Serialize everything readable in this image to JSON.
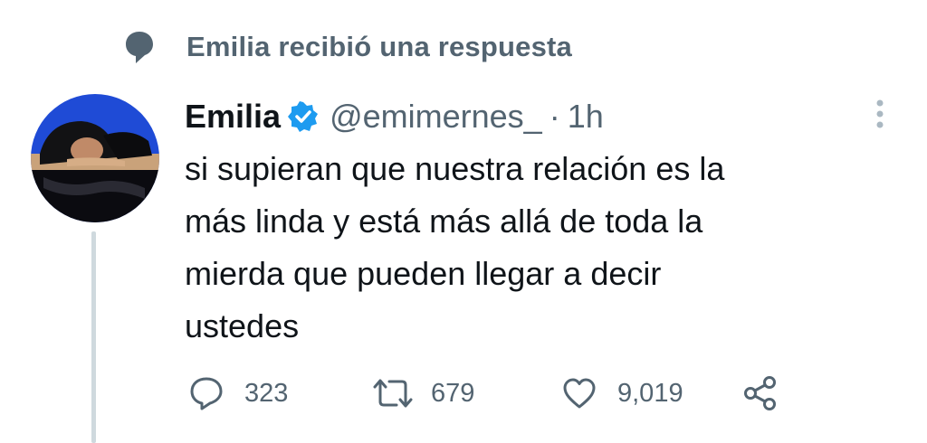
{
  "context": {
    "icon": "speech-bubble-icon",
    "text": "Emilia recibió una respuesta"
  },
  "tweet": {
    "avatar_icon": "profile-photo",
    "display_name": "Emilia",
    "verified_icon": "verified-badge-icon",
    "handle": "@emimernes_",
    "separator": "·",
    "timestamp": "1h",
    "more_icon": "more-vertical-icon",
    "text": "si supieran que nuestra relación es la\nmás linda y está más allá de toda la\nmierda que pueden llegar a decir\nustedes"
  },
  "actions": {
    "reply": {
      "icon": "reply-icon",
      "count": "323"
    },
    "retweet": {
      "icon": "retweet-icon",
      "count": "679"
    },
    "like": {
      "icon": "heart-icon",
      "count": "9,019"
    },
    "share": {
      "icon": "share-icon"
    }
  },
  "colors": {
    "text_primary": "#0f1419",
    "text_secondary": "#536471",
    "verified_blue": "#1d9bf0",
    "thread_line": "#cfd9de",
    "avatar_bg": "#1f4bd6"
  }
}
